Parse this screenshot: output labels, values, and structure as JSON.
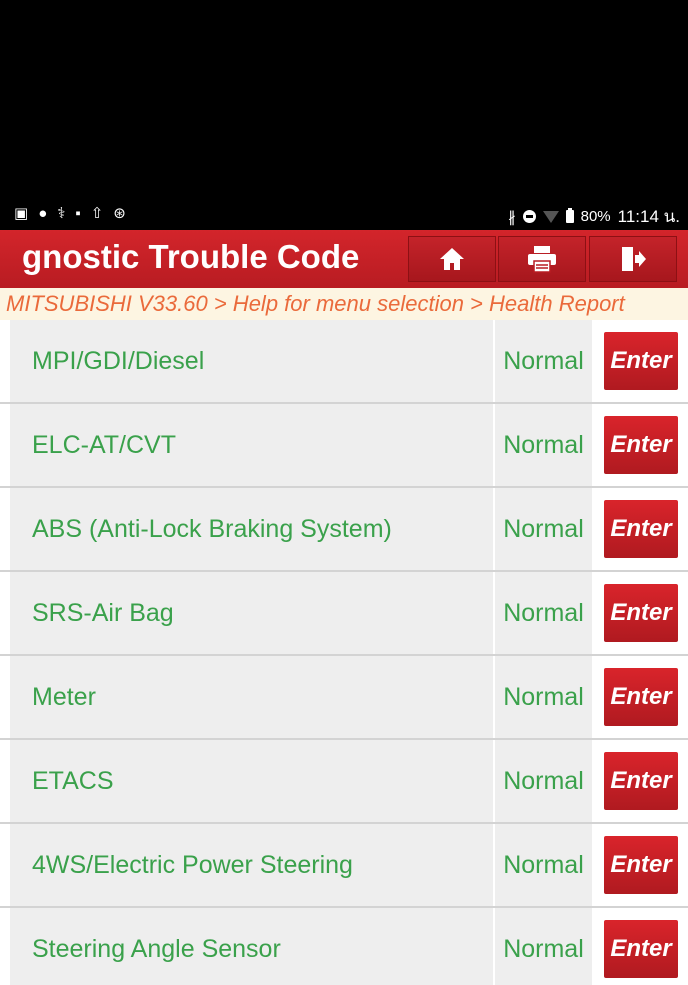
{
  "status_bar": {
    "left_icons": [
      "gmail-icon",
      "chat-icon",
      "diagnostic-icon",
      "image-icon",
      "upload-icon",
      "bluetooth-app-icon"
    ],
    "battery": "80%",
    "time": "11:14 น."
  },
  "header": {
    "title": "gnostic Trouble Code",
    "home_icon": "home-icon",
    "print_icon": "printer-icon",
    "exit_icon": "exit-icon"
  },
  "breadcrumb": "MITSUBISHI V33.60 > Help for menu selection > Health Report",
  "systems": [
    {
      "name": "MPI/GDI/Diesel",
      "status": "Normal",
      "button": "Enter"
    },
    {
      "name": "ELC-AT/CVT",
      "status": "Normal",
      "button": "Enter"
    },
    {
      "name": "ABS (Anti-Lock Braking System)",
      "status": "Normal",
      "button": "Enter"
    },
    {
      "name": "SRS-Air Bag",
      "status": "Normal",
      "button": "Enter"
    },
    {
      "name": "Meter",
      "status": "Normal",
      "button": "Enter"
    },
    {
      "name": "ETACS",
      "status": "Normal",
      "button": "Enter"
    },
    {
      "name": "4WS/Electric Power Steering",
      "status": "Normal",
      "button": "Enter"
    },
    {
      "name": "Steering Angle Sensor",
      "status": "Normal",
      "button": "Enter"
    }
  ],
  "colors": {
    "header_red": "#c8222a",
    "text_green": "#3aa14b",
    "breadcrumb_orange": "#ea6a3b",
    "breadcrumb_bg": "#fdf5e2"
  }
}
